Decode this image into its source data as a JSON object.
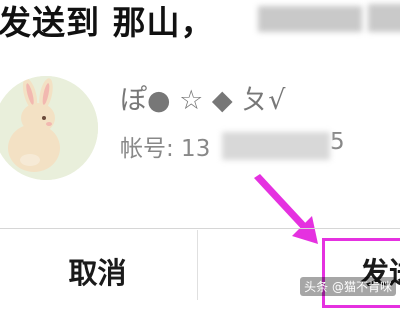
{
  "dialog": {
    "title": "发送到 那山，",
    "recipient": {
      "name": "ぽ● ☆ ◆ ㄆ√",
      "account_prefix": "帐号: 13",
      "account_suffix": "5",
      "avatar_icon": "rabbit-avatar"
    },
    "buttons": {
      "cancel_label": "取消",
      "send_label": "发送"
    }
  },
  "annotation": {
    "arrow_color": "#e531e0",
    "highlight_color": "#e531e0"
  },
  "watermark": "头条 @猫不肯咪"
}
